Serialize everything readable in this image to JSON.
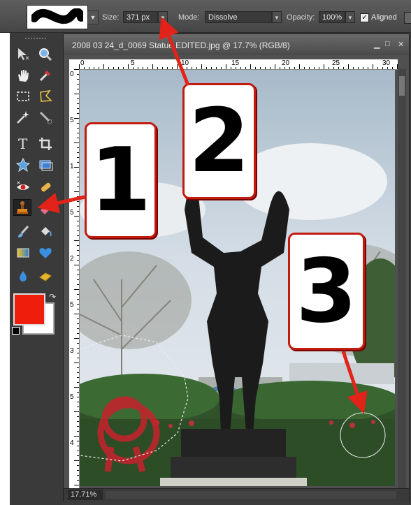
{
  "options_bar": {
    "size_label": "Size:",
    "size_value": "371 px",
    "mode_label": "Mode:",
    "mode_value": "Dissolve",
    "opacity_label": "Opacity:",
    "opacity_value": "100%",
    "aligned_label": "Aligned",
    "aligned_checked": true
  },
  "toolbox": {
    "tools": [
      "move-tool-icon",
      "zoom-tool-icon",
      "hand-tool-icon",
      "eyedropper-tool-icon",
      "marquee-tool-icon",
      "lasso-tool-icon",
      "magic-wand-tool-icon",
      "quick-selection-tool-icon",
      "type-tool-icon",
      "crop-tool-icon",
      "cookie-cutter-tool-icon",
      "straighten-tool-icon",
      "red-eye-tool-icon",
      "spot-healing-tool-icon",
      "clone-stamp-tool-icon",
      "eraser-tool-icon",
      "brush-tool-icon",
      "paint-bucket-tool-icon",
      "gradient-tool-icon",
      "custom-shape-tool-icon",
      "blur-tool-icon",
      "sponge-tool-icon"
    ],
    "active_tool": "clone-stamp-tool-icon",
    "foreground_color": "#ef1e0c",
    "background_color": "#ffffff"
  },
  "document": {
    "title": "2008 03 24_d_0069 Statue EDITED.jpg @ 17.7% (RGB/8)",
    "zoom": "17.71%",
    "ruler_h": [
      "0",
      "5",
      "10",
      "15",
      "20",
      "25",
      "30"
    ],
    "ruler_v": [
      "0",
      "5",
      "1",
      "5",
      "2",
      "5",
      "3",
      "5",
      "4"
    ]
  },
  "callouts": [
    {
      "label": "1"
    },
    {
      "label": "2"
    },
    {
      "label": "3"
    }
  ],
  "colors": {
    "callout_border": "#c21c10",
    "arrow": "#e2231a"
  }
}
